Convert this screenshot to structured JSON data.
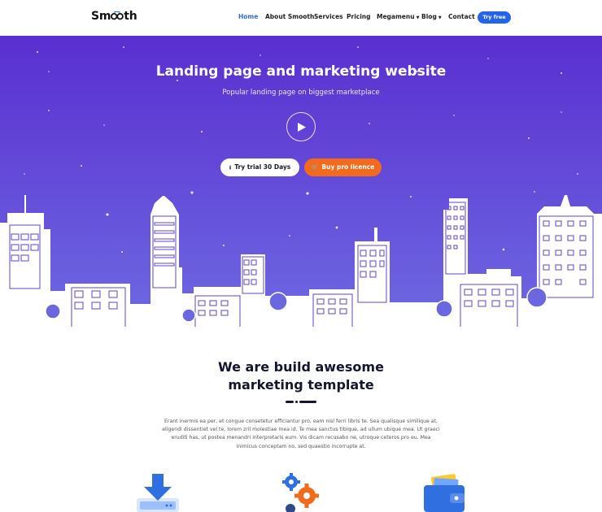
{
  "brand": {
    "name_prefix": "Sm",
    "name_suffix": "th"
  },
  "nav": {
    "items": [
      {
        "label": "Home",
        "active": true
      },
      {
        "label": "About Smooth"
      },
      {
        "label": "Services"
      },
      {
        "label": "Pricing"
      },
      {
        "label": "Megamenu",
        "dropdown": true
      },
      {
        "label": "Blog",
        "dropdown": true
      },
      {
        "label": "Contact"
      }
    ],
    "cta_label": "Try free"
  },
  "hero": {
    "title": "Landing page and marketing website",
    "subtitle": "Popular landing page on biggest marketplace",
    "trial_button": "Try trial 30 Days",
    "buy_button": "Buy pro licence"
  },
  "about": {
    "title_line1": "We are build awesome",
    "title_line2": "marketing template",
    "body": [
      "Erant inermis ea per, et congue consetetur efficiantur pro, eam nisl ferri libris te. Sea qualisque similique at,",
      "eligendi dissentiet vel te, lorem zril molestiae mea id. Te mea sanctus tibique, ad ullum ubique mea. Ut graeci",
      "eruditi has, ut postea menandri interpretaris eum. Vis dicam recusabo ne, utroque ceteros pro eu. Mea",
      "inimicus conceptam no, sed quaestio incorrupte at."
    ]
  },
  "colors": {
    "accent": "#2563eb",
    "hero_top": "#5a2fd0",
    "hero_bottom": "#6d6ae2",
    "buy": "#f26b1d"
  },
  "icons": [
    "play-icon",
    "download-icon",
    "cart-icon",
    "download-server-icon",
    "gears-icon",
    "wallet-icon"
  ]
}
